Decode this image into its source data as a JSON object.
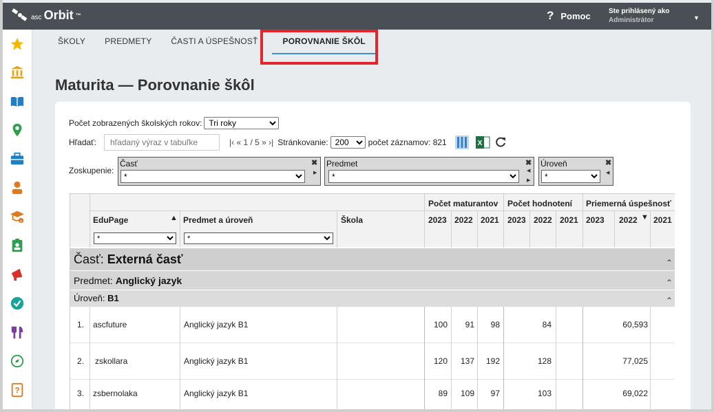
{
  "app": {
    "logo_text": "Orbit",
    "logo_prefix": "asc",
    "logo_tm": "™"
  },
  "topbar": {
    "help_label": "Pomoc",
    "help_icon": "?",
    "user_line1": "Ste prihlásený ako",
    "user_line2": "Administrátor"
  },
  "sidebar": {
    "items": [
      "star-icon",
      "bank-icon",
      "book-icon",
      "location-pin-icon",
      "briefcase-icon",
      "student-icon",
      "graduation-add-icon",
      "clipboard-user-icon",
      "megaphone-icon",
      "check-circle-icon",
      "food-icon",
      "compass-icon",
      "help-book-icon"
    ]
  },
  "tabs": [
    {
      "label": "ŠKOLY"
    },
    {
      "label": "PREDMETY"
    },
    {
      "label": "ČASTI A ÚSPEŠNOSŤ"
    },
    {
      "label": "POROVNANIE ŠKÔL",
      "active": true
    }
  ],
  "page": {
    "title": "Maturita — Porovnanie škôl"
  },
  "controls": {
    "years_label": "Počet zobrazených školských rokov:",
    "years_value": "Tri roky",
    "search_label": "Hľadať:",
    "search_placeholder": "hľadaný výraz v tabuľke",
    "pager": "|‹ « 1 / 5 » ›|",
    "paging_label": "Stránkovanie:",
    "paging_value": "200",
    "count_label": "počet záznamov: 821",
    "grouping_label": "Zoskupenie:"
  },
  "groups": [
    {
      "label": "Časť",
      "value": "*"
    },
    {
      "label": "Predmet",
      "value": "*"
    },
    {
      "label": "Úroveň",
      "value": "*"
    }
  ],
  "table": {
    "col_edupage": "EduPage",
    "col_predmet": "Predmet a úroveň",
    "col_skola": "Škola",
    "grp_maturantov": "Počet maturantov",
    "grp_hodnoteni": "Počet hodnotení",
    "grp_uspesnost": "Priemerná úspešnosť",
    "years": [
      "2023",
      "2022",
      "2021"
    ],
    "filter_value": "*",
    "group_cast_label": "Časť:",
    "group_cast_value": "Externá časť",
    "group_predmet_label": "Predmet:",
    "group_predmet_value": "Anglický jazyk",
    "group_uroven_label": "Úroveň:",
    "group_uroven_value": "B1",
    "rows": [
      {
        "n": "1.",
        "edupage": "ascfuture",
        "predmet": "Anglický jazyk B1",
        "skola": "",
        "m2023": "100",
        "m2022": "91",
        "m2021": "98",
        "h2023": "",
        "h2022": "84",
        "h2021": "",
        "u2023": "",
        "u2022": "60,593",
        "u2021": ""
      },
      {
        "n": "2.",
        "edupage": "zskollara",
        "predmet": "Anglický jazyk B1",
        "skola": "",
        "m2023": "120",
        "m2022": "137",
        "m2021": "192",
        "h2023": "",
        "h2022": "128",
        "h2021": "",
        "u2023": "",
        "u2022": "77,025",
        "u2021": ""
      },
      {
        "n": "3.",
        "edupage": "zsbernolaka",
        "predmet": "Anglický jazyk B1",
        "skola": "",
        "m2023": "89",
        "m2022": "109",
        "m2021": "97",
        "h2023": "",
        "h2022": "103",
        "h2021": "",
        "u2023": "",
        "u2022": "69,022",
        "u2021": ""
      }
    ]
  },
  "colors": {
    "topbar": "#4a4e55",
    "accent": "#3a8fd6",
    "highlight": "#e3242b"
  }
}
